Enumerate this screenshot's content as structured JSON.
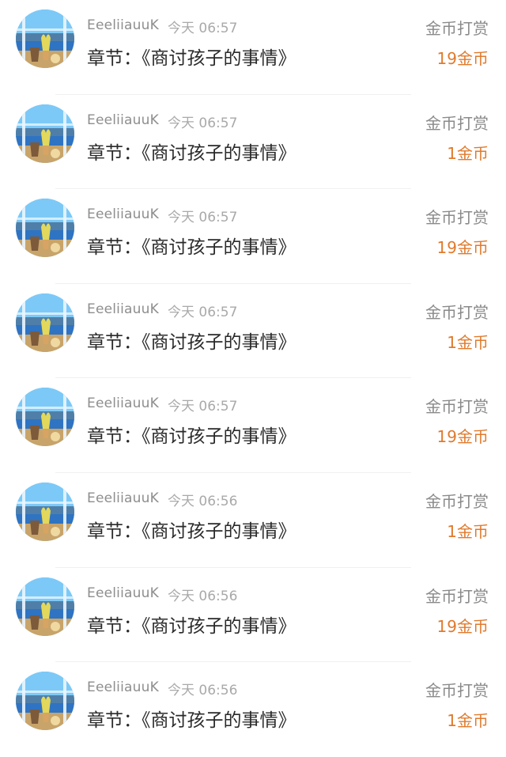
{
  "list": {
    "items": [
      {
        "username": "EeeliiauuK",
        "time": "今天 06:57",
        "chapter": "章节：《商讨孩子的事情》",
        "action": "金币打赏",
        "amount": "19金币"
      },
      {
        "username": "EeeliiauuK",
        "time": "今天 06:57",
        "chapter": "章节：《商讨孩子的事情》",
        "action": "金币打赏",
        "amount": "1金币"
      },
      {
        "username": "EeeliiauuK",
        "time": "今天 06:57",
        "chapter": "章节：《商讨孩子的事情》",
        "action": "金币打赏",
        "amount": "19金币"
      },
      {
        "username": "EeeliiauuK",
        "time": "今天 06:57",
        "chapter": "章节：《商讨孩子的事情》",
        "action": "金币打赏",
        "amount": "1金币"
      },
      {
        "username": "EeeliiauuK",
        "time": "今天 06:57",
        "chapter": "章节：《商讨孩子的事情》",
        "action": "金币打赏",
        "amount": "19金币"
      },
      {
        "username": "EeeliiauuK",
        "time": "今天 06:56",
        "chapter": "章节：《商讨孩子的事情》",
        "action": "金币打赏",
        "amount": "1金币"
      },
      {
        "username": "EeeliiauuK",
        "time": "今天 06:56",
        "chapter": "章节：《商讨孩子的事情》",
        "action": "金币打赏",
        "amount": "19金币"
      },
      {
        "username": "EeeliiauuK",
        "time": "今天 06:56",
        "chapter": "章节：《商讨孩子的事情》",
        "action": "金币打赏",
        "amount": "1金币"
      }
    ]
  },
  "colors": {
    "accent": "#e07a2c",
    "muted": "#8e8e8e",
    "text": "#2a2a2a"
  },
  "icons": {
    "avatar": "avatar-beach-window-image"
  }
}
